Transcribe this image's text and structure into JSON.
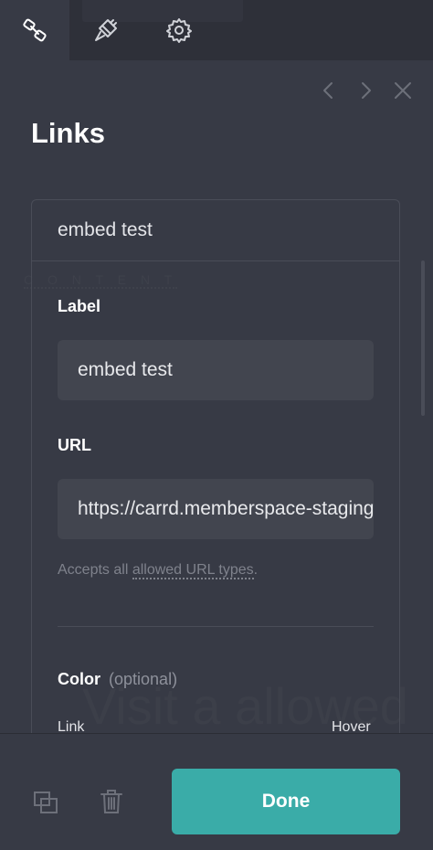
{
  "tabs": [
    {
      "icon": "link-icon",
      "active": true
    },
    {
      "icon": "paintbrush-icon",
      "active": false
    },
    {
      "icon": "gear-icon",
      "active": false
    }
  ],
  "nav": {
    "prev_icon": "chevron-left-icon",
    "next_icon": "chevron-right-icon",
    "close_icon": "close-icon"
  },
  "panel": {
    "title": "Links"
  },
  "background": {
    "ghost_small": "C O N T E N T",
    "ghost_large": "Visit a allowed"
  },
  "card": {
    "header": "embed test",
    "label_field": {
      "label": "Label",
      "value": "embed test"
    },
    "url_field": {
      "label": "URL",
      "value": "https://carrd.memberspace-staging"
    },
    "hint": {
      "prefix": "Accepts all ",
      "link": "allowed URL types",
      "suffix": "."
    },
    "color": {
      "label": "Color",
      "optional": "(optional)",
      "link_label": "Link",
      "hover_label": "Hover"
    }
  },
  "footer": {
    "duplicate_icon": "duplicate-icon",
    "delete_icon": "trash-icon",
    "done_label": "Done"
  },
  "colors": {
    "background": "#373a45",
    "tabbar": "#2e3039",
    "input": "#42454f",
    "accent": "#3aaca8"
  }
}
